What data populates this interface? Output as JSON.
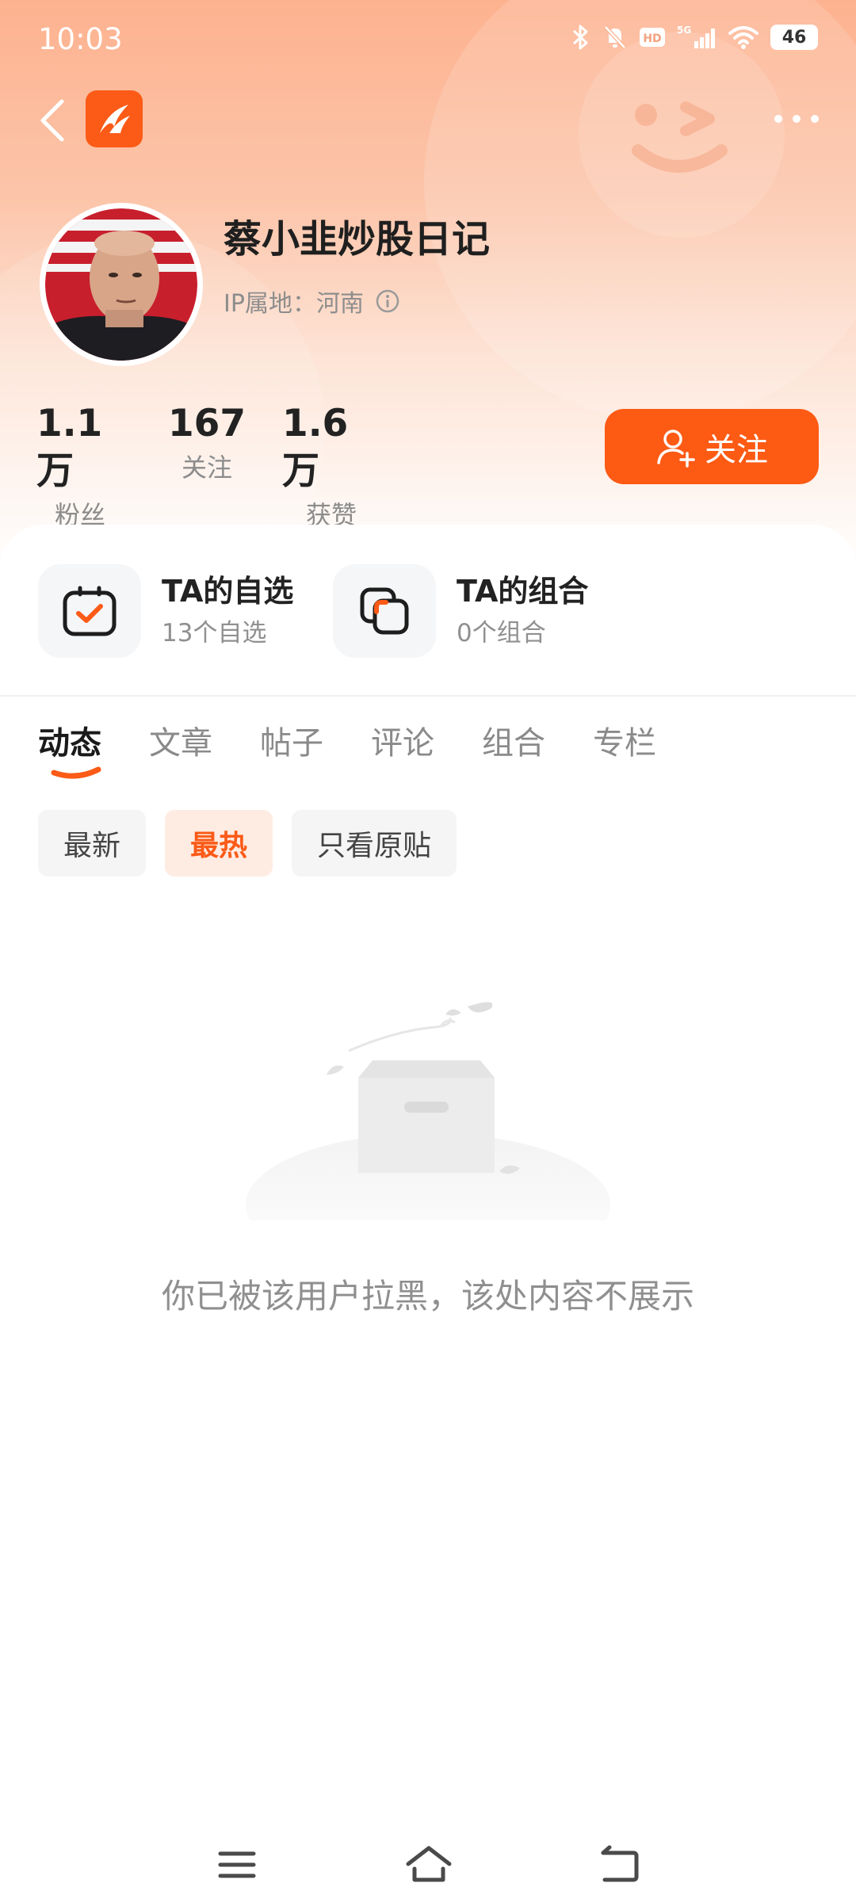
{
  "status_bar": {
    "time": "10:03",
    "network": "5G",
    "hd": "HD",
    "battery": "46"
  },
  "profile": {
    "name": "蔡小韭炒股日记",
    "ip_label": "IP属地：河南"
  },
  "stats": [
    {
      "value": "1.1万",
      "label": "粉丝"
    },
    {
      "value": "167",
      "label": "关注"
    },
    {
      "value": "1.6万",
      "label": "获赞"
    }
  ],
  "follow_button": {
    "label": "关注"
  },
  "entries": [
    {
      "title": "TA的自选",
      "subtitle": "13个自选"
    },
    {
      "title": "TA的组合",
      "subtitle": "0个组合"
    }
  ],
  "tabs": [
    {
      "label": "动态",
      "active": true
    },
    {
      "label": "文章",
      "active": false
    },
    {
      "label": "帖子",
      "active": false
    },
    {
      "label": "评论",
      "active": false
    },
    {
      "label": "组合",
      "active": false
    },
    {
      "label": "专栏",
      "active": false
    }
  ],
  "filters": [
    {
      "label": "最新",
      "active": false
    },
    {
      "label": "最热",
      "active": true
    },
    {
      "label": "只看原贴",
      "active": false
    }
  ],
  "empty_state": {
    "message": "你已被该用户拉黑，该处内容不展示"
  },
  "colors": {
    "accent": "#fd5a14",
    "header_top": "#fdb28f"
  },
  "icons": {
    "back": "chevron-left-icon",
    "more": "more-dots-icon",
    "info": "info-icon",
    "follow": "add-user-icon",
    "watchlist": "checkbox-icon",
    "portfolio": "overlap-squares-icon",
    "nav_menu": "menu-icon",
    "nav_home": "home-icon",
    "nav_back": "back-arrow-icon"
  }
}
